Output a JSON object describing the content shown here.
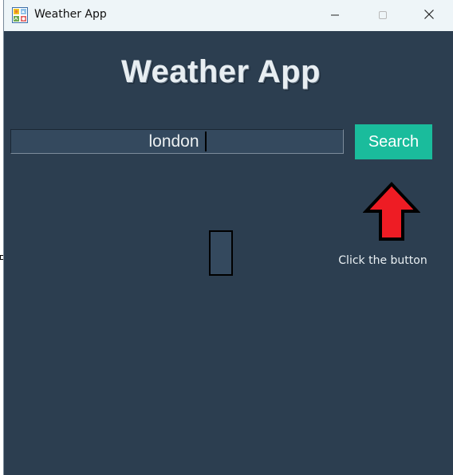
{
  "window": {
    "title": "Weather App",
    "icon": "weather-app-icon",
    "controls": {
      "minimize_icon": "minimize-icon",
      "maximize_icon": "maximize-icon",
      "close_icon": "close-icon"
    }
  },
  "main": {
    "heading": "Weather App",
    "search": {
      "value": "london",
      "button_label": "Search"
    },
    "hint": {
      "text": "Click the button",
      "arrow_icon": "up-arrow-icon",
      "arrow_color": "#ee1c24"
    }
  },
  "colors": {
    "background": "#2c3e50",
    "input_background": "#34495e",
    "accent": "#1abc9c",
    "titlebar": "#eef5f8"
  }
}
